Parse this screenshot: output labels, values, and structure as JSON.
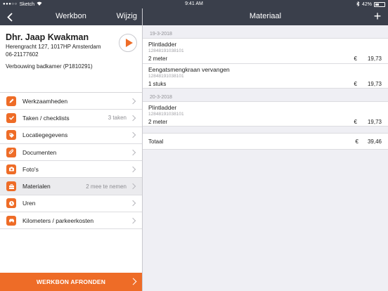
{
  "status_bar": {
    "carrier": "Sketch",
    "time": "9:41 AM",
    "battery": "42%",
    "battery_level": 0.42
  },
  "left_nav": {
    "title": "Werkbon",
    "edit_label": "Wijzig"
  },
  "right_nav": {
    "title": "Materiaal",
    "add_label": "+"
  },
  "customer": {
    "name": "Dhr. Jaap Kwakman",
    "address": "Herengracht 127, 1017HP Amsterdam",
    "phone": "06-21177602",
    "project": "Verbouwing badkamer (P1810291)"
  },
  "menu": [
    {
      "label": "Werkzaamheden",
      "detail": "",
      "icon": "pencil-icon"
    },
    {
      "label": "Taken / checklists",
      "detail": "3 taken",
      "icon": "checkmark-icon"
    },
    {
      "label": "Locatiegegevens",
      "detail": "",
      "icon": "tag-icon"
    },
    {
      "label": "Documenten",
      "detail": "",
      "icon": "paperclip-icon"
    },
    {
      "label": "Foto's",
      "detail": "",
      "icon": "camera-icon"
    },
    {
      "label": "Materialen",
      "detail": "2 mee te nemen",
      "icon": "toolbox-icon",
      "selected": true
    },
    {
      "label": "Uren",
      "detail": "",
      "icon": "clock-icon"
    },
    {
      "label": "Kilometers / parkeerkosten",
      "detail": "",
      "icon": "car-icon"
    }
  ],
  "finish_button": "WERKBON AFRONDEN",
  "sections": [
    {
      "date": "19-3-2018",
      "items": [
        {
          "name": "Plintladder",
          "code": "12848191038101",
          "quantity": "2 meter",
          "currency": "€",
          "price": "19,73"
        },
        {
          "name": "Eengatsmengkraan vervangen",
          "code": "12848191038101",
          "quantity": "1 stuks",
          "currency": "€",
          "price": "19,73"
        }
      ]
    },
    {
      "date": "20-3-2018",
      "items": [
        {
          "name": "Plintladder",
          "code": "12848191038101",
          "quantity": "2 meter",
          "currency": "€",
          "price": "19,73"
        }
      ]
    }
  ],
  "total": {
    "label": "Totaal",
    "currency": "€",
    "value": "39,46"
  },
  "colors": {
    "accent": "#ee6c27",
    "navbar": "#3a3f4b",
    "background": "#efeff4"
  }
}
